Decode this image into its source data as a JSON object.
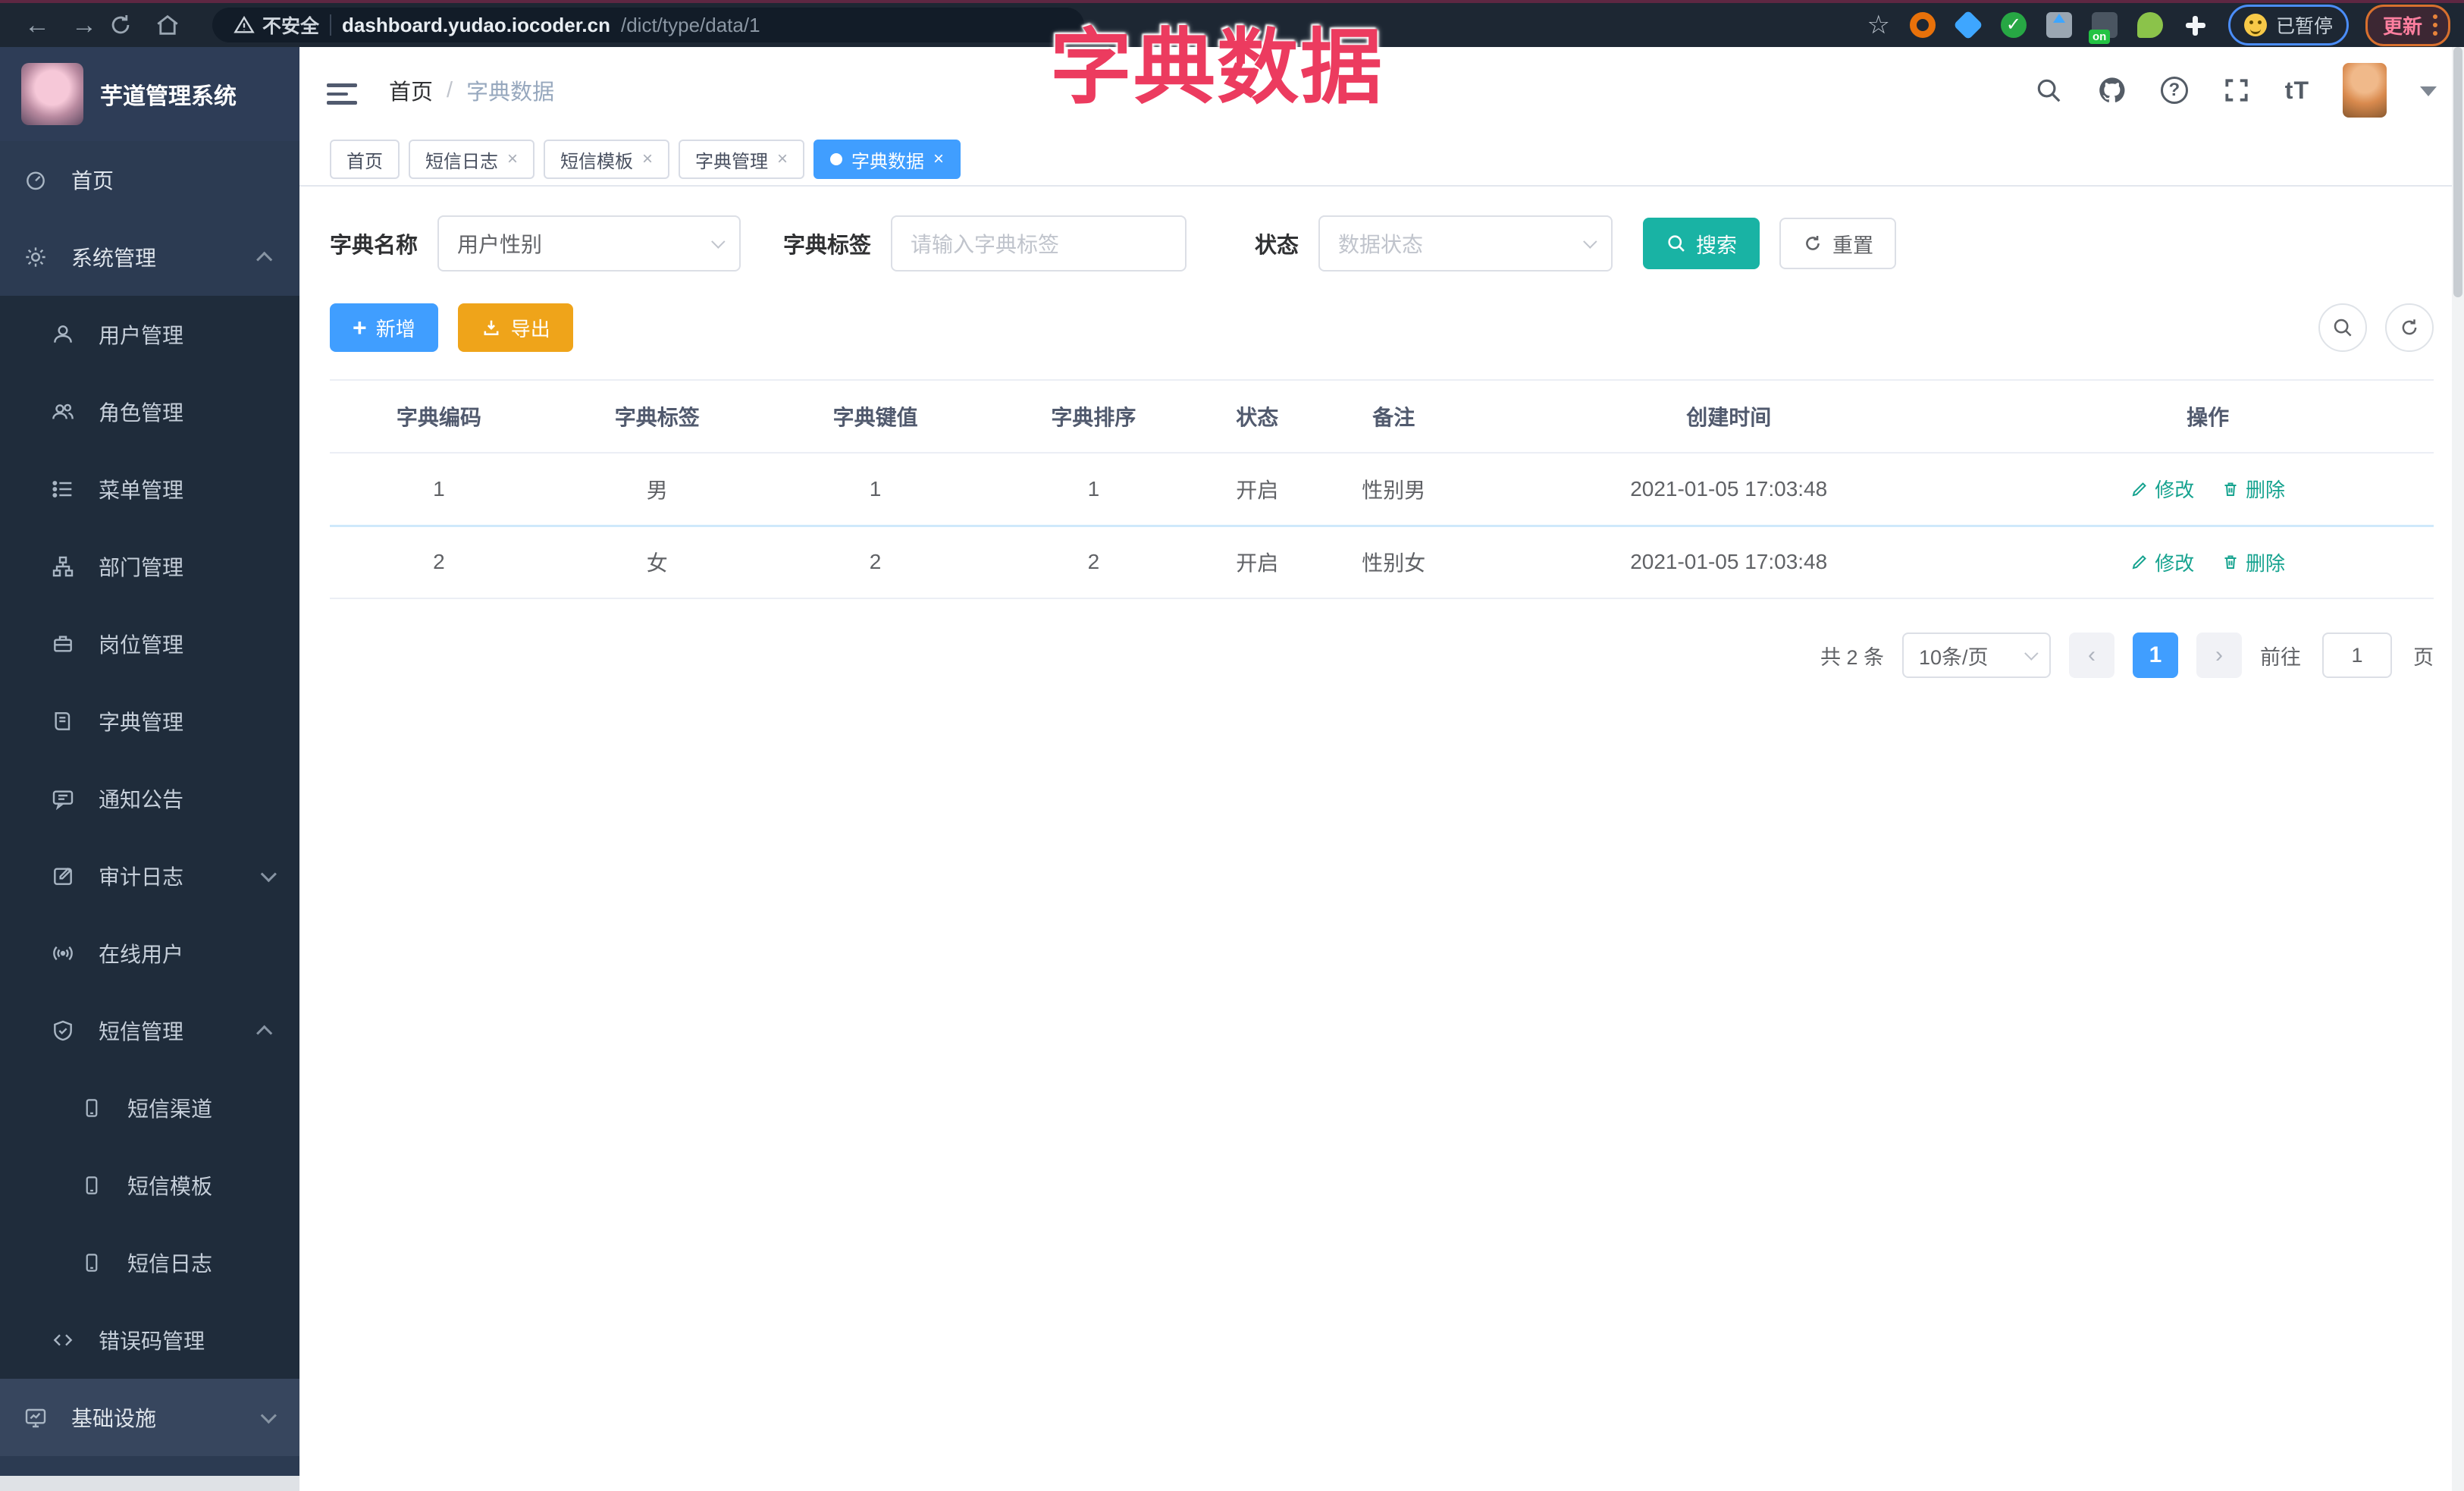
{
  "browser": {
    "security_label": "不安全",
    "url_host": "dashboard.yudao.iocoder.cn",
    "url_path": "/dict/type/data/1",
    "ext_on_badge": "on",
    "paused_label": "已暂停",
    "update_label": "更新"
  },
  "overlay_title": "字典数据",
  "sidebar": {
    "app_title": "芋道管理系统",
    "items": [
      {
        "label": "首页"
      },
      {
        "label": "系统管理"
      },
      {
        "label": "用户管理"
      },
      {
        "label": "角色管理"
      },
      {
        "label": "菜单管理"
      },
      {
        "label": "部门管理"
      },
      {
        "label": "岗位管理"
      },
      {
        "label": "字典管理"
      },
      {
        "label": "通知公告"
      },
      {
        "label": "审计日志"
      },
      {
        "label": "在线用户"
      },
      {
        "label": "短信管理"
      },
      {
        "label": "短信渠道"
      },
      {
        "label": "短信模板"
      },
      {
        "label": "短信日志"
      },
      {
        "label": "错误码管理"
      },
      {
        "label": "基础设施"
      }
    ]
  },
  "header": {
    "breadcrumb_home": "首页",
    "breadcrumb_separator": "/",
    "breadcrumb_current": "字典数据"
  },
  "tabs": [
    {
      "label": "首页"
    },
    {
      "label": "短信日志"
    },
    {
      "label": "短信模板"
    },
    {
      "label": "字典管理"
    },
    {
      "label": "字典数据"
    }
  ],
  "filters": {
    "dict_name_label": "字典名称",
    "dict_name_value": "用户性别",
    "dict_label_label": "字典标签",
    "dict_label_placeholder": "请输入字典标签",
    "status_label": "状态",
    "status_placeholder": "数据状态",
    "search_label": "搜索",
    "reset_label": "重置"
  },
  "toolbar": {
    "add_label": "新增",
    "export_label": "导出"
  },
  "table": {
    "headers": [
      "字典编码",
      "字典标签",
      "字典键值",
      "字典排序",
      "状态",
      "备注",
      "创建时间",
      "操作"
    ],
    "rows": [
      {
        "code": "1",
        "label": "男",
        "value": "1",
        "sort": "1",
        "status": "开启",
        "remark": "性别男",
        "created": "2021-01-05 17:03:48"
      },
      {
        "code": "2",
        "label": "女",
        "value": "2",
        "sort": "2",
        "status": "开启",
        "remark": "性别女",
        "created": "2021-01-05 17:03:48"
      }
    ],
    "edit_label": "修改",
    "delete_label": "删除"
  },
  "pagination": {
    "total_label": "共 2 条",
    "page_size_label": "10条/页",
    "current_page": "1",
    "goto_label": "前往",
    "goto_value": "1",
    "page_unit_label": "页"
  },
  "colors": {
    "primary_blue": "#409eff",
    "teal_accent": "#19b3a4",
    "export_amber": "#efa41a",
    "overlay_pink": "#ec3b5f",
    "sidebar_bg": "#2c3b52",
    "submenu_bg": "#1f2c3b"
  }
}
